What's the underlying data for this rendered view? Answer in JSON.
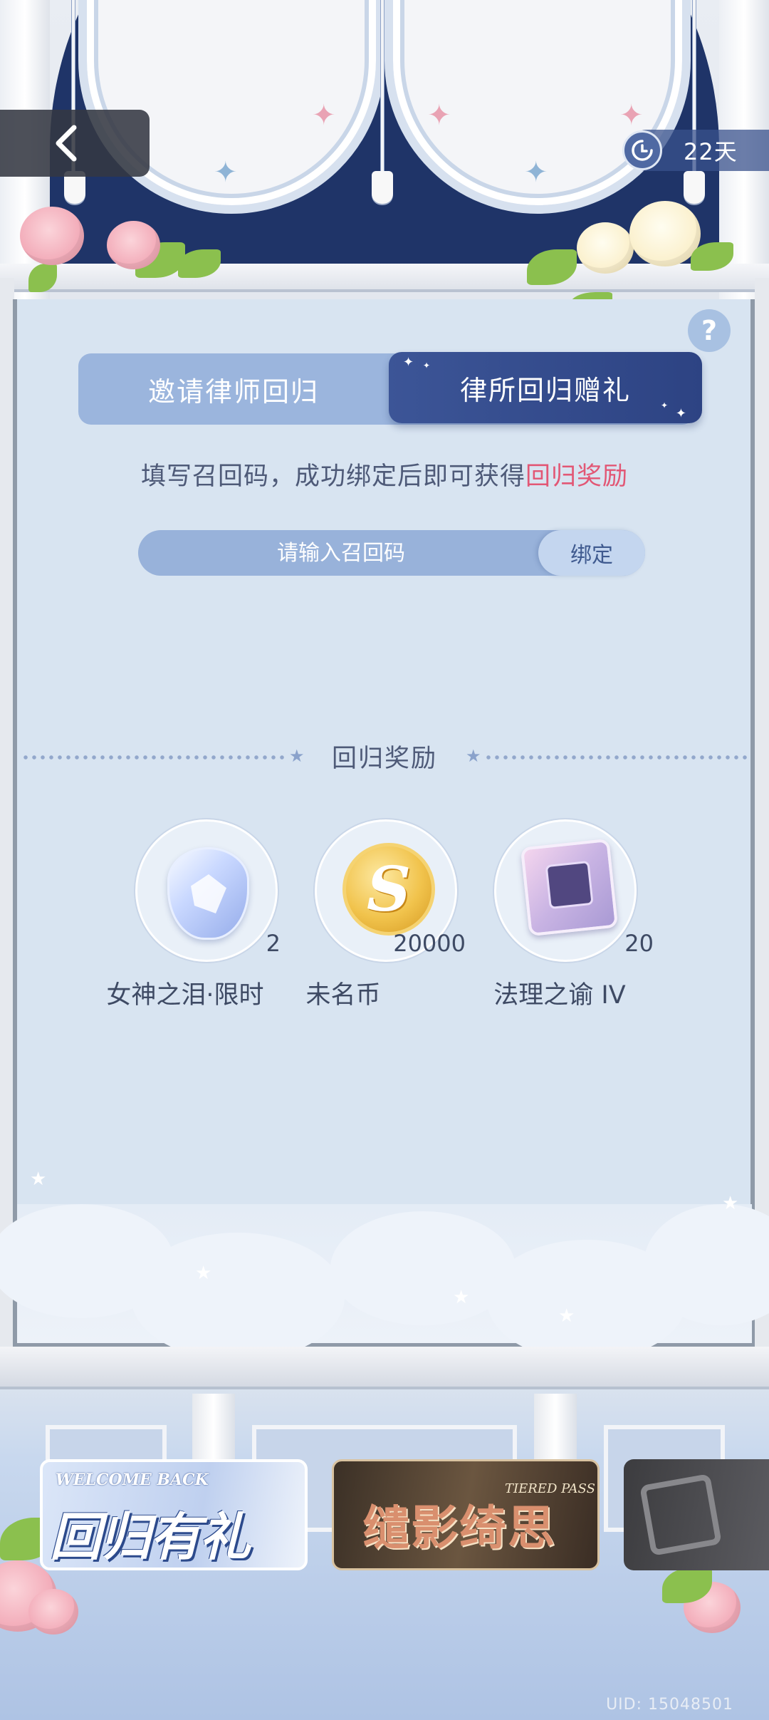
{
  "header": {
    "timer_text": "22天"
  },
  "tabs": [
    {
      "label": "邀请律师回归",
      "active": false
    },
    {
      "label": "律所回归赠礼",
      "active": true
    }
  ],
  "hint": {
    "prefix": "填写召回码，成功绑定后即可获得",
    "highlight": "回归奖励"
  },
  "code_form": {
    "placeholder": "请输入召回码",
    "bind_label": "绑定"
  },
  "help_label": "?",
  "rewards_section": {
    "title": "回归奖励",
    "items": [
      {
        "name": "女神之泪·限时",
        "quantity": "2",
        "icon": "teardrop-gem-icon"
      },
      {
        "name": "未名币",
        "quantity": "20000",
        "icon": "gold-coin-icon"
      },
      {
        "name": "法理之谕 IV",
        "quantity": "20",
        "icon": "chip-card-icon"
      }
    ]
  },
  "banners": [
    {
      "en": "WELCOME BACK",
      "cn": "回归有礼"
    },
    {
      "en": "TIERED PASS",
      "cn": "缱影绮思"
    },
    {
      "en": "",
      "cn": ""
    }
  ],
  "footer": {
    "uid": "UID: 15048501"
  },
  "colors": {
    "accent_dark": "#2d4383",
    "accent_light": "#9bb5dd",
    "highlight": "#e25775",
    "text": "#4e5a78"
  }
}
